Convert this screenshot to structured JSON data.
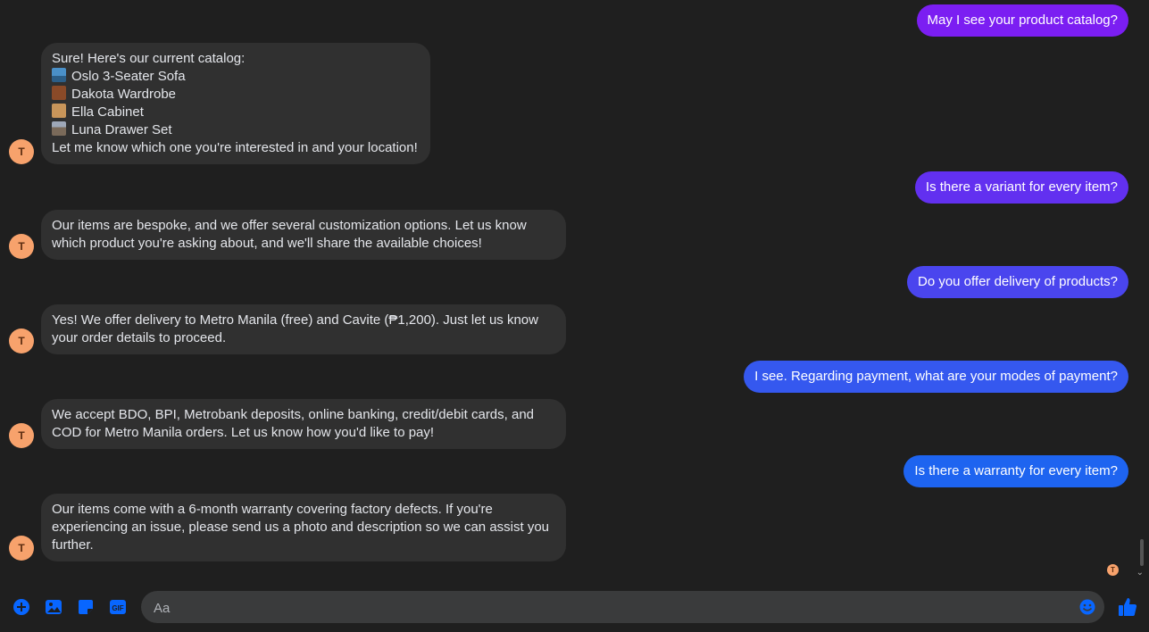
{
  "colors": {
    "background": "#1f1f1f",
    "incoming_bubble": "#303030",
    "accent_blue": "#0866ff",
    "avatar": "#f7a26c"
  },
  "contact": {
    "avatar_initial": "T"
  },
  "messages": [
    {
      "from": "user",
      "text": "May I see your product catalog?",
      "color": "#7b1ef2"
    },
    {
      "from": "page",
      "intro": "Sure! Here's our current catalog:",
      "items": [
        {
          "icon": "sofa-emoji",
          "label": "Oslo 3-Seater Sofa"
        },
        {
          "icon": "door-emoji",
          "label": "Dakota Wardrobe"
        },
        {
          "icon": "package-emoji",
          "label": "Ella Cabinet"
        },
        {
          "icon": "drawer-emoji",
          "label": "Luna Drawer Set"
        }
      ],
      "outro": "Let me know which one you're interested in and your location!"
    },
    {
      "from": "user",
      "text": "Is there a variant for every item?",
      "color": "#6230f0"
    },
    {
      "from": "page",
      "lines": [
        "Our items are bespoke, and we offer several customization options. Let us know",
        "which product you're asking about, and we'll share the available choices!"
      ]
    },
    {
      "from": "user",
      "text": "Do you offer delivery of products?",
      "color": "#4a45ee"
    },
    {
      "from": "page",
      "lines": [
        "Yes! We offer delivery to Metro Manila (free) and Cavite (₱1,200). Just let us know",
        "your order details to proceed."
      ]
    },
    {
      "from": "user",
      "text": "I see. Regarding payment, what are your modes of payment?",
      "color": "#3558ef"
    },
    {
      "from": "page",
      "lines": [
        "We accept BDO, BPI, Metrobank deposits, online banking, credit/debit cards, and",
        "COD for Metro Manila orders. Let us know how you'd like to pay!"
      ]
    },
    {
      "from": "user",
      "text": "Is there a warranty for every item?",
      "color": "#1e64f0"
    },
    {
      "from": "page",
      "lines": [
        "Our items come with a 6-month warranty covering factory defects. If you're",
        "experiencing an issue, please send us a photo and description so we can assist you",
        "further."
      ]
    }
  ],
  "composer": {
    "placeholder": "Aa",
    "tools": [
      "plus-icon",
      "image-icon",
      "sticker-icon",
      "gif-icon"
    ],
    "gif_label": "GIF"
  }
}
